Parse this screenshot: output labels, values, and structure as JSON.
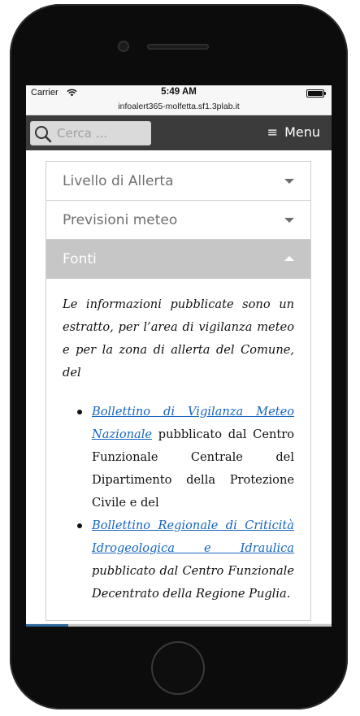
{
  "status_bar": {
    "carrier": "Carrier",
    "time": "5:49 AM"
  },
  "url_bar": {
    "url": "infoalert365-molfetta.sf1.3plab.it"
  },
  "nav": {
    "search_placeholder": "Cerca ...",
    "menu_label": "Menu",
    "menu_icon": "hamburger-icon"
  },
  "accordion": {
    "sections": [
      {
        "title": "Livello di Allerta",
        "expanded": false
      },
      {
        "title": "Previsioni meteo",
        "expanded": false
      },
      {
        "title": "Fonti",
        "expanded": true
      }
    ],
    "fonti": {
      "intro": "Le informazioni pubblicate sono un estratto, per l’area di vigilanza meteo e per la zona di allerta del Comune, del",
      "items": [
        {
          "link": "Bollettino di Vigilanza Meteo Nazionale",
          "text": " pubblicato dal Centro Funzionale Centrale del Dipartimento della Protezione Civile e del"
        },
        {
          "link": "Bollettino Regionale di Criticità Idrogeologica e Idraulica",
          "text": " pubblicato dal Centro Funzionale Decentrato della Regione Puglia."
        }
      ]
    }
  },
  "colors": {
    "nav_bg": "#3b3b3b",
    "active_header_bg": "#c6c6c6",
    "link": "#1565c0"
  }
}
